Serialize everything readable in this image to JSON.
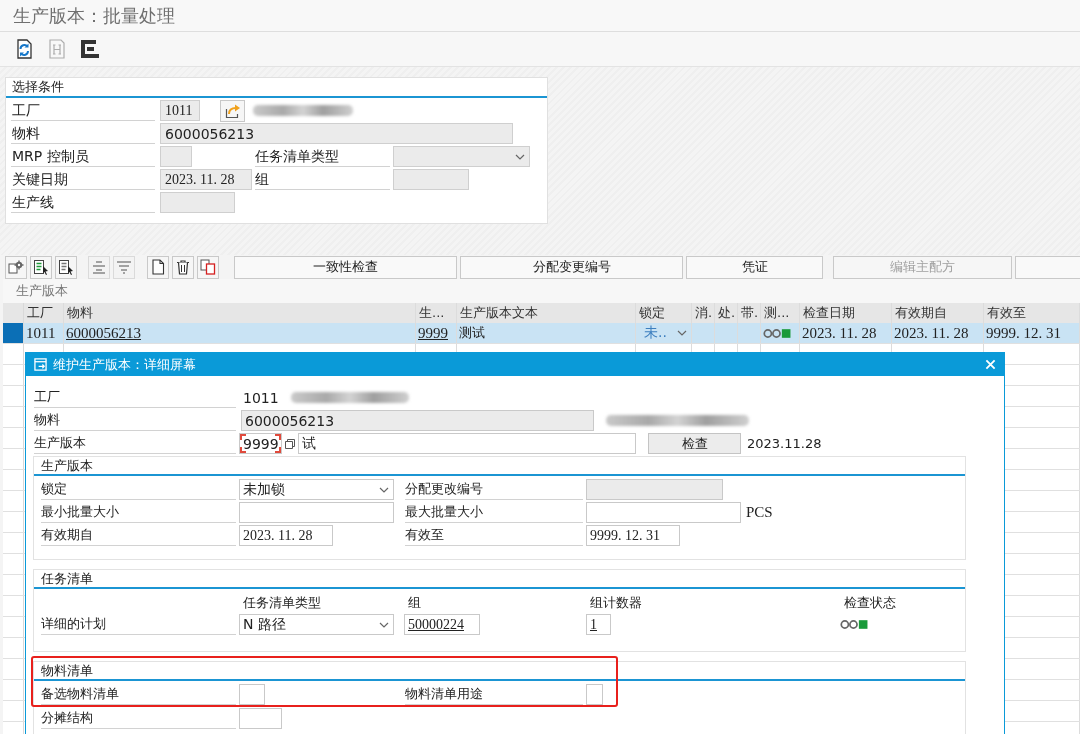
{
  "window": {
    "title": "生产版本：批量处理"
  },
  "toolbar": [
    {
      "kind": "refresh",
      "disabled": false
    },
    {
      "kind": "header",
      "disabled": true
    },
    {
      "kind": "hierarchy",
      "disabled": false
    }
  ],
  "selection": {
    "title": "选择条件",
    "plant": {
      "label": "工厂",
      "value": "1011",
      "disabled": true
    },
    "material": {
      "label": "物料",
      "value": "6000056213",
      "disabled": true
    },
    "mrp_controller": {
      "label": "MRP 控制员",
      "disabled": true
    },
    "task_list_type": {
      "label": "任务清单类型",
      "disabled": true
    },
    "key_date": {
      "label": "关键日期",
      "value": "2023. 11. 28",
      "disabled": true
    },
    "group": {
      "label": "组",
      "disabled": true
    },
    "production_line": {
      "label": "生产线",
      "disabled": true
    }
  },
  "table_toolbar": {
    "icons": [
      {
        "kind": "details",
        "disabled": false
      },
      {
        "kind": "select",
        "disabled": false
      },
      {
        "kind": "deselect",
        "disabled": false
      },
      {
        "kind": "align",
        "disabled": true
      },
      {
        "kind": "filter",
        "disabled": true
      },
      {
        "kind": "create",
        "disabled": false
      },
      {
        "kind": "delete",
        "disabled": false
      },
      {
        "kind": "copy",
        "disabled": false
      }
    ],
    "buttons": [
      {
        "label": "一致性检查",
        "disabled": false
      },
      {
        "label": "分配变更编号",
        "disabled": false
      },
      {
        "label": "凭证",
        "disabled": false
      },
      {
        "label": "编辑主配方",
        "disabled": true
      }
    ]
  },
  "table": {
    "title": "生产版本",
    "columns": [
      "工厂",
      "物料",
      "生...",
      "生产版本文本",
      "锁定",
      "消.",
      "处.",
      "带.",
      "测...",
      "检查日期",
      "有效期自",
      "有效至"
    ],
    "rows": [
      {
        "selected": true,
        "plant": "1011",
        "material": "6000056213",
        "version": "9999",
        "version_text": "测试",
        "lock": "未..",
        "status": {
          "color": "#1a9a3a"
        },
        "check_date": "2023. 11. 28",
        "valid_from": "2023. 11. 28",
        "valid_to": "9999. 12. 31"
      }
    ]
  },
  "dialog": {
    "title": "维护生产版本：详细屏幕",
    "plant": {
      "label": "工厂",
      "value": "1011"
    },
    "material": {
      "label": "物料",
      "value": "6000056213",
      "disabled": true
    },
    "version": {
      "label": "生产版本",
      "value": "9999",
      "focused": true,
      "text": "试"
    },
    "check_button": "检查",
    "check_date": "2023.11.28",
    "version_section": {
      "title": "生产版本",
      "lock": {
        "label": "锁定",
        "value": "未加锁"
      },
      "change_number": {
        "label": "分配更改编号",
        "disabled": true
      },
      "min_lot": {
        "label": "最小批量大小"
      },
      "max_lot": {
        "label": "最大批量大小",
        "unit": "PCS"
      },
      "valid_from": {
        "label": "有效期自",
        "value": "2023. 11. 28"
      },
      "valid_to": {
        "label": "有效至",
        "value": "9999. 12. 31"
      }
    },
    "task_list_section": {
      "title": "任务清单",
      "columns": [
        "任务清单类型",
        "组",
        "组计数器",
        "检查状态"
      ],
      "label": "详细的计划",
      "type": "N 路径",
      "group": "50000224",
      "counter": "1",
      "status": {
        "color": "#1a9a3a"
      }
    },
    "bom_section": {
      "title": "物料清单",
      "highlighted": true,
      "alternative": {
        "label": "备选物料清单"
      },
      "usage": {
        "label": "物料清单用途"
      },
      "apportionment": {
        "label": "分摊结构"
      }
    }
  }
}
